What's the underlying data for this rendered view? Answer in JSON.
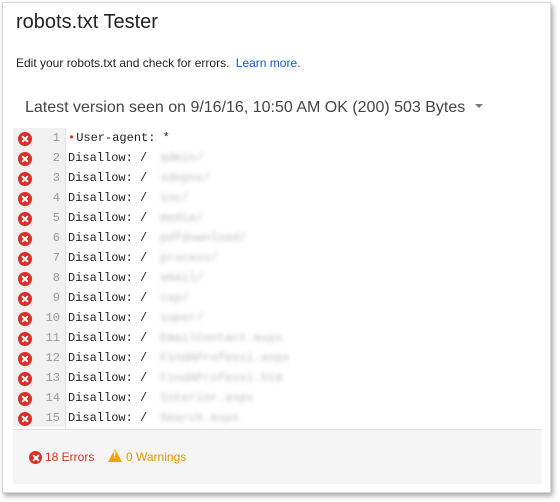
{
  "page": {
    "title": "robots.txt Tester",
    "description": "Edit your robots.txt and check for errors.",
    "learn_more": "Learn more.",
    "version_label": "Latest version seen on 9/16/16, 10:50 AM OK (200) 503 Bytes"
  },
  "editor": {
    "lines": [
      {
        "num": "1",
        "text": "User-agent: *",
        "hidden": ""
      },
      {
        "num": "2",
        "text": "Disallow: /",
        "hidden": "admin/"
      },
      {
        "num": "3",
        "text": "Disallow: /",
        "hidden": "sdepns/"
      },
      {
        "num": "4",
        "text": "Disallow: /",
        "hidden": "inc/"
      },
      {
        "num": "5",
        "text": "Disallow: /",
        "hidden": "media/"
      },
      {
        "num": "6",
        "text": "Disallow: /",
        "hidden": "pdfdownload/"
      },
      {
        "num": "7",
        "text": "Disallow: /",
        "hidden": "process/"
      },
      {
        "num": "8",
        "text": "Disallow: /",
        "hidden": "email/"
      },
      {
        "num": "9",
        "text": "Disallow: /",
        "hidden": "cap/"
      },
      {
        "num": "10",
        "text": "Disallow: /",
        "hidden": "super/"
      },
      {
        "num": "11",
        "text": "Disallow: /",
        "hidden": "EmailContact.aspx"
      },
      {
        "num": "12",
        "text": "Disallow: /",
        "hidden": "FindAProfessi.aspx"
      },
      {
        "num": "13",
        "text": "Disallow: /",
        "hidden": "FindAProfessi.htm"
      },
      {
        "num": "14",
        "text": "Disallow: /",
        "hidden": "Interior.aspx"
      },
      {
        "num": "15",
        "text": "Disallow: /",
        "hidden": "Search.aspx"
      }
    ]
  },
  "footer": {
    "errors": "18 Errors",
    "warnings": "0 Warnings"
  },
  "colors": {
    "error": "#d93025",
    "warning": "#f5a300",
    "link": "#1155cc"
  },
  "icons": {
    "error": "error-x-circle-icon",
    "warning": "warning-triangle-icon",
    "dropdown": "caret-down-icon"
  }
}
